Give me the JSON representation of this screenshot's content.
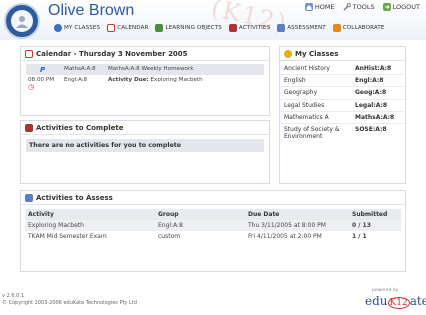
{
  "header": {
    "user_name": "Olive Brown",
    "watermark": "(K12)",
    "top_nav": [
      {
        "label": "HOME"
      },
      {
        "label": "TOOLS"
      },
      {
        "label": "LOGOUT"
      }
    ],
    "main_nav": [
      {
        "label": "MY CLASSES"
      },
      {
        "label": "CALENDAR"
      },
      {
        "label": "LEARNING OBJECTS"
      },
      {
        "label": "ACTIVITIES"
      },
      {
        "label": "ASSESSMENT"
      },
      {
        "label": "COLLABORATE"
      }
    ]
  },
  "calendar": {
    "title": "Calendar - Thursday 3 November 2005",
    "rows": [
      {
        "time": "",
        "group": "MathsA:A:8",
        "desc_prefix": "",
        "desc": "MathsA:A:8 Weekly Homework"
      },
      {
        "time": "08:00 PM",
        "group": "Engl:A:8",
        "desc_prefix": "Activity Due:",
        "desc": "Exploring Macbeth"
      }
    ]
  },
  "my_classes": {
    "title": "My Classes",
    "rows": [
      {
        "name": "Ancient History",
        "code": "AnHist:A:8"
      },
      {
        "name": "English",
        "code": "Engl:A:8"
      },
      {
        "name": "Geography",
        "code": "Geog:A:8"
      },
      {
        "name": "Legal Studies",
        "code": "Legal:A:8"
      },
      {
        "name": "Mathematics A",
        "code": "MathsA:A:8"
      },
      {
        "name": "Study of Society & Environment",
        "code": "SOSE:A:8"
      }
    ]
  },
  "activities_complete": {
    "title": "Activities to Complete",
    "empty_message": "There are no activities for you to complete"
  },
  "activities_assess": {
    "title": "Activities to Assess",
    "headers": [
      "Activity",
      "Group",
      "Due Date",
      "Submitted"
    ],
    "rows": [
      [
        "Exploring Macbeth",
        "Engl:A:8",
        "Thu 3/11/2005 at 8:00 PM",
        "0 / 13"
      ],
      [
        "TKAM Mid Semester Exam",
        "custom",
        "Fri 4/11/2005 at 2:00 PM",
        "1 / 1"
      ]
    ]
  },
  "footer": {
    "version": "v 2.6.0.1",
    "copyright": "© Copyright 2003-2006 eduKate Technologies Pty Ltd",
    "powered_by": "powered by",
    "brand_pre": "edu",
    "brand_k": "K12",
    "brand_post": "ate"
  },
  "colors": {
    "brand_blue": "#2d5b9c",
    "brand_red": "#cc3333"
  }
}
